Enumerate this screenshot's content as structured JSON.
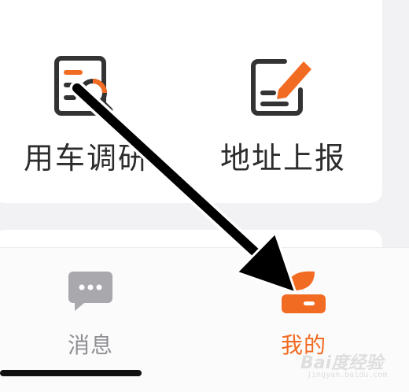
{
  "grid": {
    "items": [
      {
        "label": "用车调研",
        "icon": "survey-search-icon"
      },
      {
        "label": "地址上报",
        "icon": "edit-report-icon"
      }
    ]
  },
  "tabbar": {
    "tabs": [
      {
        "label": "消息",
        "icon": "chat-bubble-icon",
        "active": false
      },
      {
        "label": "我的",
        "icon": "profile-icon",
        "active": true
      }
    ]
  },
  "colors": {
    "accent": "#f26b22",
    "inactive": "#8e8e93",
    "text": "#2c2c2c",
    "background": "#f2f2f4"
  },
  "watermark": {
    "brand": "Bai度经验",
    "url": "jingyan.baidu.com"
  }
}
